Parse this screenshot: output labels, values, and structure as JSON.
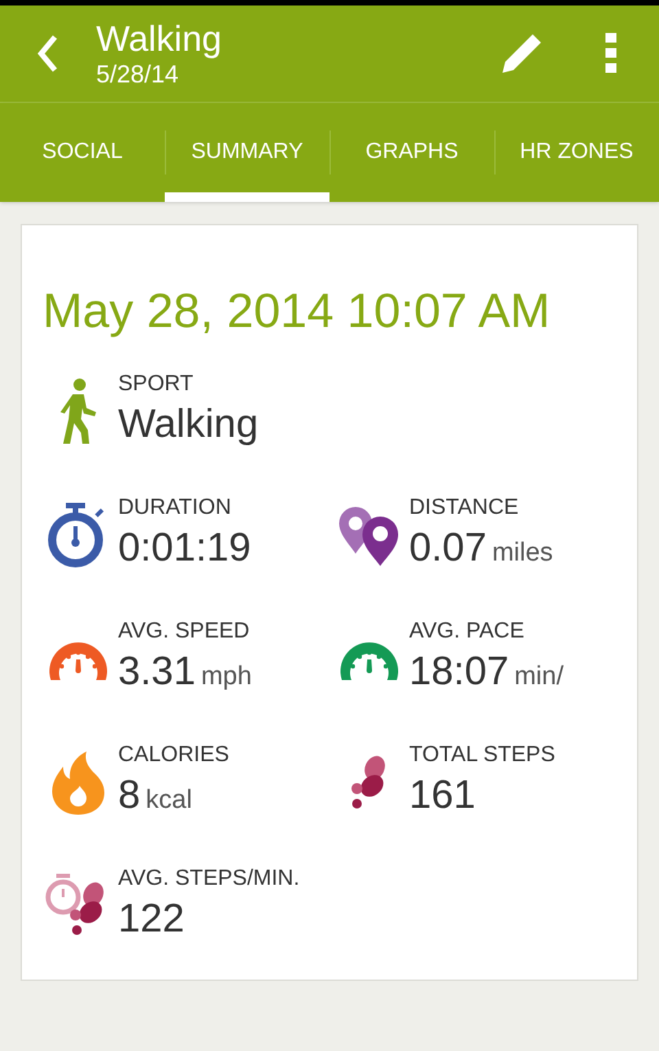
{
  "header": {
    "title": "Walking",
    "subtitle": "5/28/14"
  },
  "tabs": [
    {
      "label": "SOCIAL",
      "selected": false
    },
    {
      "label": "SUMMARY",
      "selected": true
    },
    {
      "label": "GRAPHS",
      "selected": false
    },
    {
      "label": "HR ZONES",
      "selected": false
    }
  ],
  "summary": {
    "datetime": "May 28, 2014 10:07 AM",
    "metrics": [
      {
        "kind": "sport",
        "label": "SPORT",
        "value": "Walking"
      },
      {
        "kind": "duration",
        "label": "DURATION",
        "value": "0:01:19"
      },
      {
        "kind": "distance",
        "label": "DISTANCE",
        "value": "0.07",
        "unit": "miles"
      },
      {
        "kind": "speed",
        "label": "AVG. SPEED",
        "value": "3.31",
        "unit": "mph"
      },
      {
        "kind": "pace",
        "label": "AVG. PACE",
        "value": "18:07",
        "unit": "min/"
      },
      {
        "kind": "calories",
        "label": "CALORIES",
        "value": "8",
        "unit": "kcal"
      },
      {
        "kind": "steps",
        "label": "TOTAL STEPS",
        "value": "161"
      },
      {
        "kind": "cadence",
        "label": "AVG. STEPS/MIN.",
        "value": "122"
      }
    ]
  }
}
